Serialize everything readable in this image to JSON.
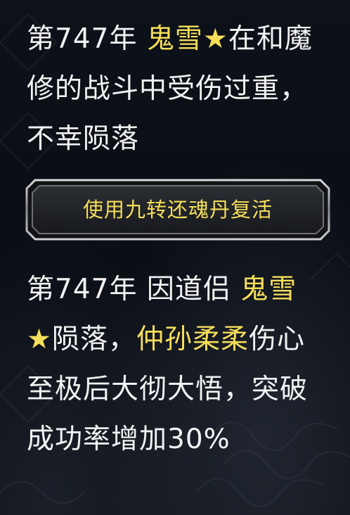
{
  "event1": {
    "year": "第747年",
    "name": "鬼雪★",
    "text": "在和魔修的战斗中受伤过重，不幸陨落"
  },
  "revive_button": {
    "label": "使用九转还魂丹复活"
  },
  "event2": {
    "year_cause": "第747年 因道侣 ",
    "partner": "鬼雪★",
    "mid": "陨落，",
    "name": "仲孙柔柔",
    "text": "伤心至极后大彻大悟，突破成功率增加30%"
  },
  "colors": {
    "highlight": "#f5de5a",
    "text": "#f2f2f2",
    "background": "#0b0f17"
  }
}
